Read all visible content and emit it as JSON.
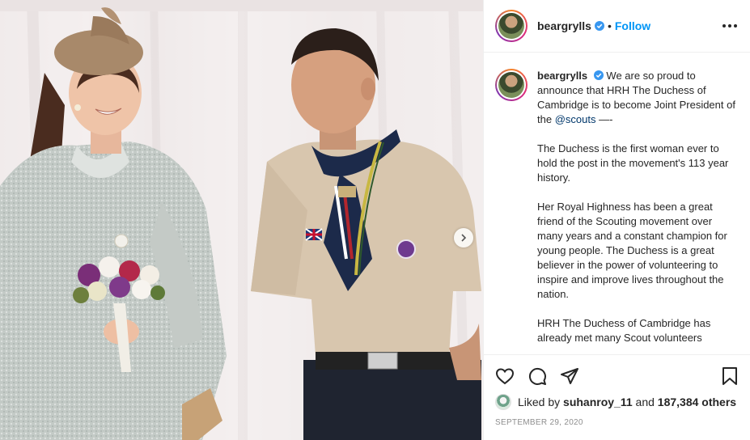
{
  "header": {
    "username": "beargrylls",
    "separator": "•",
    "follow_label": "Follow"
  },
  "caption": {
    "username": "beargrylls",
    "intro": "We are so proud to announce that HRH The Duchess of Cambridge is to become Joint President of the ",
    "mention": "@scouts",
    "intro_tail": " —-",
    "paragraphs": [
      "The Duchess is the first woman ever to hold the post in the movement's 113 year history.",
      "Her Royal Highness has been a great friend of the Scouting movement over many years and a constant champion for young people. The Duchess is a great believer in the power of volunteering to inspire and improve lives throughout the nation.",
      "HRH The Duchess of Cambridge has already met many Scout volunteers"
    ]
  },
  "likes": {
    "prefix": "Liked by ",
    "user": "suhanroy_11",
    "middle": " and ",
    "count": "187,384 others"
  },
  "date": "SEPTEMBER 29, 2020",
  "icons": {
    "verified": "verified-badge-icon",
    "more": "more-options-icon",
    "like": "heart-icon",
    "comment": "comment-icon",
    "share": "share-icon",
    "save": "bookmark-icon",
    "next": "chevron-right-icon"
  },
  "colors": {
    "link": "#0095f6",
    "mention": "#00376b",
    "verified": "#3897f0",
    "muted": "#8e8e8e"
  }
}
